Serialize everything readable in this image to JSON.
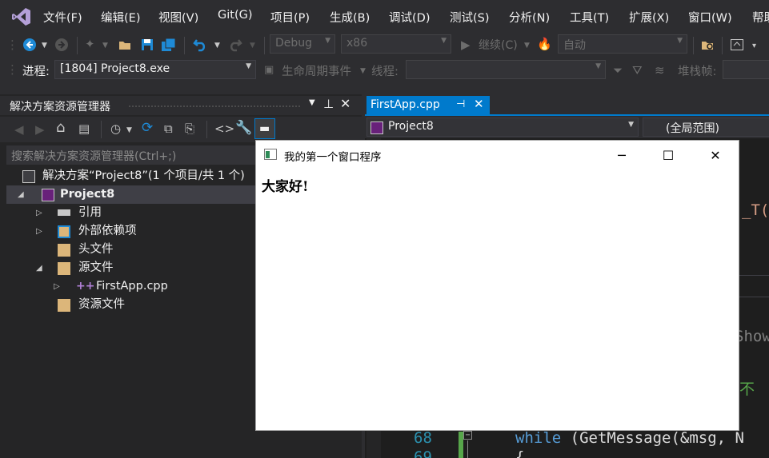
{
  "menu": [
    "文件(F)",
    "编辑(E)",
    "视图(V)",
    "Git(G)",
    "项目(P)",
    "生成(B)",
    "调试(D)",
    "测试(S)",
    "分析(N)",
    "工具(T)",
    "扩展(X)",
    "窗口(W)",
    "帮助"
  ],
  "toolbar": {
    "config": "Debug",
    "platform": "x86",
    "continue": "继续(C)",
    "auto": "自动"
  },
  "debug_bar": {
    "process_label": "进程:",
    "process_value": "[1804] Project8.exe",
    "lifecycle": "生命周期事件",
    "thread_label": "线程:",
    "stack_label": "堆栈帧:"
  },
  "solution_explorer": {
    "title": "解决方案资源管理器",
    "search_placeholder": "搜索解决方案资源管理器(Ctrl+;)",
    "tree": [
      {
        "label": "解决方案“Project8”(1 个项目/共 1 个)"
      },
      {
        "label": "Project8"
      },
      {
        "label": "引用"
      },
      {
        "label": "外部依赖项"
      },
      {
        "label": "头文件"
      },
      {
        "label": "源文件"
      },
      {
        "label": "FirstApp.cpp"
      },
      {
        "label": "资源文件"
      }
    ]
  },
  "editor": {
    "tab": "FirstApp.cpp",
    "nav_project": "Project8",
    "nav_scope": "(全局范围)",
    "line_number": "68",
    "line_number_next": "69",
    "code_keyword": "while",
    "code_rest": " (GetMessage(&msg, N",
    "frag_t": "_T(\"",
    "frag_show": "Show",
    "frag_bu": "不",
    "frag_brace": "{"
  },
  "app_window": {
    "title": "我的第一个窗口程序",
    "content": "大家好!",
    "minimize": "─",
    "maximize": "☐",
    "close": "✕"
  },
  "colors": {
    "accent": "#007acc",
    "keyword": "#569cd6",
    "line_number": "#2b91af",
    "comment": "#57a64a"
  }
}
